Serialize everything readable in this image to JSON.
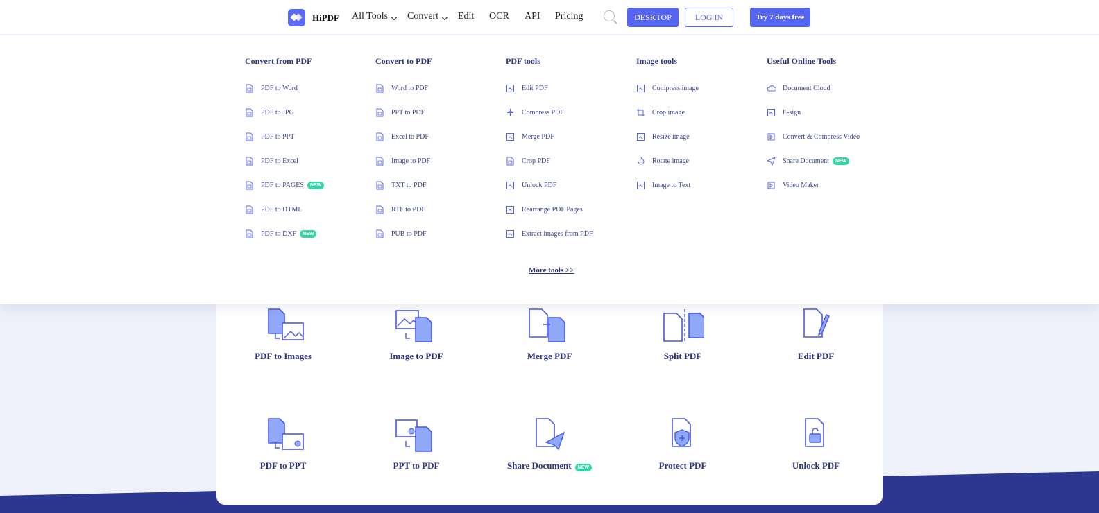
{
  "header": {
    "logo_text": "HiPDF",
    "nav": [
      "All Tools",
      "Convert",
      "Edit",
      "OCR",
      "API",
      "Pricing"
    ],
    "desktop_label": "DESKTOP",
    "login_label": "LOG IN",
    "try_label": "Try 7 days free"
  },
  "mega_menu": {
    "columns": [
      {
        "title": "Convert from PDF",
        "items": [
          {
            "label": "PDF to Word",
            "icon": "word-doc-icon"
          },
          {
            "label": "PDF to JPG",
            "icon": "image-doc-icon"
          },
          {
            "label": "PDF to PPT",
            "icon": "ppt-doc-icon"
          },
          {
            "label": "PDF to Excel",
            "icon": "excel-doc-icon"
          },
          {
            "label": "PDF to PAGES",
            "icon": "pages-doc-icon",
            "badge": "NEW"
          },
          {
            "label": "PDF to HTML",
            "icon": "html-doc-icon"
          },
          {
            "label": "PDF to DXF",
            "icon": "dxf-doc-icon",
            "badge": "NEW"
          }
        ]
      },
      {
        "title": "Convert to PDF",
        "items": [
          {
            "label": "Word to PDF",
            "icon": "word-doc-icon"
          },
          {
            "label": "PPT to PDF",
            "icon": "ppt-doc-icon"
          },
          {
            "label": "Excel to PDF",
            "icon": "excel-doc-icon"
          },
          {
            "label": "Image to PDF",
            "icon": "image-doc-icon"
          },
          {
            "label": "TXT to PDF",
            "icon": "txt-doc-icon"
          },
          {
            "label": "RTF to PDF",
            "icon": "rtf-doc-icon"
          },
          {
            "label": "PUB to PDF",
            "icon": "pub-doc-icon"
          }
        ]
      },
      {
        "title": "PDF tools",
        "items": [
          {
            "label": "Edit PDF",
            "icon": "text-cursor-icon"
          },
          {
            "label": "Compress PDF",
            "icon": "compress-icon"
          },
          {
            "label": "Merge PDF",
            "icon": "merge-icon"
          },
          {
            "label": "Crop PDF",
            "icon": "crop-doc-icon"
          },
          {
            "label": "Unlock PDF",
            "icon": "unlock-icon"
          },
          {
            "label": "Rearrange PDF Pages",
            "icon": "rearrange-icon"
          },
          {
            "label": "Extract images from PDF",
            "icon": "extract-image-icon"
          }
        ]
      },
      {
        "title": "Image tools",
        "items": [
          {
            "label": "Compress image",
            "icon": "compress-image-icon"
          },
          {
            "label": "Crop image",
            "icon": "crop-icon"
          },
          {
            "label": "Resize image",
            "icon": "resize-icon"
          },
          {
            "label": "Rotate image",
            "icon": "rotate-icon"
          },
          {
            "label": "Image to Text",
            "icon": "text-icon"
          }
        ]
      },
      {
        "title": "Useful Online Tools",
        "items": [
          {
            "label": "Document Cloud",
            "icon": "cloud-icon"
          },
          {
            "label": "E-sign",
            "icon": "signature-icon"
          },
          {
            "label": "Convert & Compress Video",
            "icon": "video-icon"
          },
          {
            "label": "Share Document",
            "icon": "send-icon",
            "badge": "NEW"
          },
          {
            "label": "Video Maker",
            "icon": "video-maker-icon"
          }
        ]
      }
    ],
    "more_tools": "More tools >>"
  },
  "tools": [
    {
      "label": "PDF to Images",
      "icon": "pdf-to-images-icon"
    },
    {
      "label": "Image to PDF",
      "icon": "image-to-pdf-icon"
    },
    {
      "label": "Merge PDF",
      "icon": "merge-pdf-icon"
    },
    {
      "label": "Split PDF",
      "icon": "split-pdf-icon"
    },
    {
      "label": "Edit PDF",
      "icon": "edit-pdf-icon"
    },
    {
      "label": "PDF to PPT",
      "icon": "pdf-to-ppt-icon"
    },
    {
      "label": "PPT to PDF",
      "icon": "ppt-to-pdf-icon"
    },
    {
      "label": "Share Document",
      "icon": "share-document-icon",
      "badge": "NEW"
    },
    {
      "label": "Protect PDF",
      "icon": "protect-pdf-icon"
    },
    {
      "label": "Unlock PDF",
      "icon": "unlock-pdf-icon"
    }
  ],
  "colors": {
    "accent": "#5665f1",
    "navy": "#2b357c",
    "badge": "#33d6a6",
    "band": "#2c3890"
  }
}
